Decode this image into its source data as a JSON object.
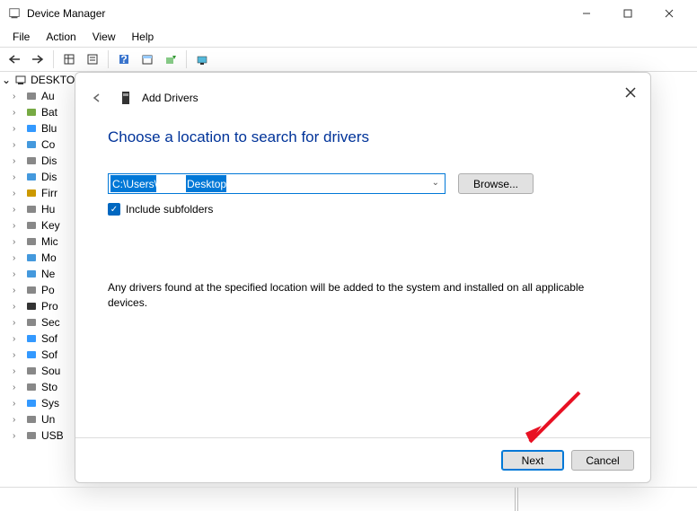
{
  "window": {
    "title": "Device Manager"
  },
  "menu": {
    "items": [
      "File",
      "Action",
      "View",
      "Help"
    ]
  },
  "tree": {
    "root": "DESKTO",
    "items": [
      {
        "label": "Au"
      },
      {
        "label": "Bat"
      },
      {
        "label": "Blu"
      },
      {
        "label": "Co"
      },
      {
        "label": "Dis"
      },
      {
        "label": "Dis"
      },
      {
        "label": "Firr"
      },
      {
        "label": "Hu"
      },
      {
        "label": "Key"
      },
      {
        "label": "Mic"
      },
      {
        "label": "Mo"
      },
      {
        "label": "Ne"
      },
      {
        "label": "Po"
      },
      {
        "label": "Pro"
      },
      {
        "label": "Sec"
      },
      {
        "label": "Sof"
      },
      {
        "label": "Sof"
      },
      {
        "label": "Sou"
      },
      {
        "label": "Sto"
      },
      {
        "label": "Sys"
      },
      {
        "label": "Un"
      },
      {
        "label": "USB"
      }
    ]
  },
  "dialog": {
    "title": "Add Drivers",
    "section_title": "Choose a location to search for drivers",
    "path": {
      "seg1": "C:\\Users\\",
      "seg2": "Desktop"
    },
    "browse": "Browse...",
    "checkbox_label": "Include subfolders",
    "description": "Any drivers found at the specified location will be added to the system and installed on all applicable devices.",
    "next": "Next",
    "cancel": "Cancel"
  }
}
